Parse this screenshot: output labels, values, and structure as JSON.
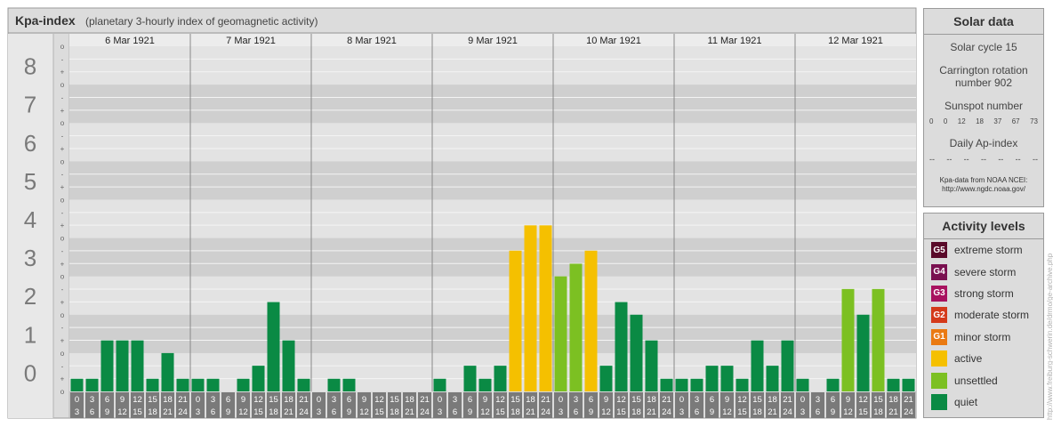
{
  "chart_data": {
    "type": "bar",
    "title": "Kpa-index",
    "subtitle": "(planetary 3-hourly index of geomagnetic activity)",
    "ylim": [
      0,
      9
    ],
    "y_ticks": [
      "0",
      "1",
      "2",
      "3",
      "4",
      "5",
      "6",
      "7",
      "8",
      "9"
    ],
    "minor_ticks": [
      "o",
      "+",
      "-"
    ],
    "days": [
      "6 Mar 1921",
      "7 Mar 1921",
      "8 Mar 1921",
      "9 Mar 1921",
      "10 Mar 1921",
      "11 Mar 1921",
      "12 Mar 1921"
    ],
    "intervals_top": [
      "0",
      "3",
      "6",
      "9",
      "12",
      "15",
      "18",
      "21"
    ],
    "intervals_bottom": [
      "3",
      "6",
      "9",
      "12",
      "15",
      "18",
      "21",
      "24"
    ],
    "values": [
      0.33,
      0.33,
      1.33,
      1.33,
      1.33,
      0.33,
      1.0,
      0.33,
      0.33,
      0.33,
      0.0,
      0.33,
      0.67,
      2.33,
      1.33,
      0.33,
      0.0,
      0.33,
      0.33,
      0.0,
      0.0,
      0.0,
      0.0,
      0.0,
      0.33,
      0.0,
      0.67,
      0.33,
      0.67,
      3.67,
      4.33,
      4.33,
      3.0,
      3.33,
      3.67,
      0.67,
      2.33,
      2.0,
      1.33,
      0.33,
      0.33,
      0.33,
      0.67,
      0.67,
      0.33,
      1.33,
      0.67,
      1.33,
      0.33,
      0.0,
      0.33,
      2.67,
      2.0,
      2.67,
      0.33,
      0.33
    ],
    "grid": true
  },
  "solar": {
    "title": "Solar data",
    "cycle": "Solar cycle 15",
    "carrington_line1": "Carrington rotation",
    "carrington_line2": "number 902",
    "sunspot_title": "Sunspot number",
    "sunspots": [
      "0",
      "0",
      "12",
      "18",
      "37",
      "67",
      "73"
    ],
    "ap_title": "Daily Ap-index",
    "ap_values": [
      "--",
      "--",
      "--",
      "--",
      "--",
      "--",
      "--"
    ],
    "source_line1": "Kpa-data from NOAA NCEI:",
    "source_line2": "http://www.ngdc.noaa.gov/"
  },
  "legend": {
    "title": "Activity levels",
    "items": [
      {
        "badge": "G5",
        "label": "extreme storm",
        "color": "#5a0a2a"
      },
      {
        "badge": "G4",
        "label": "severe storm",
        "color": "#7a1050"
      },
      {
        "badge": "G3",
        "label": "strong storm",
        "color": "#a8125f"
      },
      {
        "badge": "G2",
        "label": "moderate storm",
        "color": "#d43a1a"
      },
      {
        "badge": "G1",
        "label": "minor storm",
        "color": "#ea7a12"
      },
      {
        "badge": "",
        "label": "active",
        "color": "#f5c000"
      },
      {
        "badge": "",
        "label": "unsettled",
        "color": "#7cc022"
      },
      {
        "badge": "",
        "label": "quiet",
        "color": "#0a8a44"
      }
    ]
  },
  "watermark": "http://www.freiburg-schwerin.de/drmo/ge-archive.php"
}
